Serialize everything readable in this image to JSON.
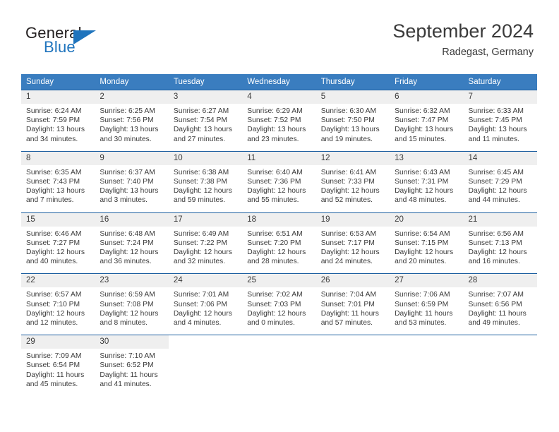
{
  "brand": {
    "name_part1": "General",
    "name_part2": "Blue",
    "mark": "triangle-logo"
  },
  "header": {
    "month_title": "September 2024",
    "location": "Radegast, Germany"
  },
  "calendar": {
    "weekday_headers": [
      "Sunday",
      "Monday",
      "Tuesday",
      "Wednesday",
      "Thursday",
      "Friday",
      "Saturday"
    ],
    "accent_header_color": "#3a7dbf",
    "accent_border_color": "#1d5fa0",
    "daynum_band_color": "#efefef",
    "weeks": [
      [
        {
          "day": "1",
          "sunrise": "Sunrise: 6:24 AM",
          "sunset": "Sunset: 7:59 PM",
          "daylight_line1": "Daylight: 13 hours",
          "daylight_line2": "and 34 minutes."
        },
        {
          "day": "2",
          "sunrise": "Sunrise: 6:25 AM",
          "sunset": "Sunset: 7:56 PM",
          "daylight_line1": "Daylight: 13 hours",
          "daylight_line2": "and 30 minutes."
        },
        {
          "day": "3",
          "sunrise": "Sunrise: 6:27 AM",
          "sunset": "Sunset: 7:54 PM",
          "daylight_line1": "Daylight: 13 hours",
          "daylight_line2": "and 27 minutes."
        },
        {
          "day": "4",
          "sunrise": "Sunrise: 6:29 AM",
          "sunset": "Sunset: 7:52 PM",
          "daylight_line1": "Daylight: 13 hours",
          "daylight_line2": "and 23 minutes."
        },
        {
          "day": "5",
          "sunrise": "Sunrise: 6:30 AM",
          "sunset": "Sunset: 7:50 PM",
          "daylight_line1": "Daylight: 13 hours",
          "daylight_line2": "and 19 minutes."
        },
        {
          "day": "6",
          "sunrise": "Sunrise: 6:32 AM",
          "sunset": "Sunset: 7:47 PM",
          "daylight_line1": "Daylight: 13 hours",
          "daylight_line2": "and 15 minutes."
        },
        {
          "day": "7",
          "sunrise": "Sunrise: 6:33 AM",
          "sunset": "Sunset: 7:45 PM",
          "daylight_line1": "Daylight: 13 hours",
          "daylight_line2": "and 11 minutes."
        }
      ],
      [
        {
          "day": "8",
          "sunrise": "Sunrise: 6:35 AM",
          "sunset": "Sunset: 7:43 PM",
          "daylight_line1": "Daylight: 13 hours",
          "daylight_line2": "and 7 minutes."
        },
        {
          "day": "9",
          "sunrise": "Sunrise: 6:37 AM",
          "sunset": "Sunset: 7:40 PM",
          "daylight_line1": "Daylight: 13 hours",
          "daylight_line2": "and 3 minutes."
        },
        {
          "day": "10",
          "sunrise": "Sunrise: 6:38 AM",
          "sunset": "Sunset: 7:38 PM",
          "daylight_line1": "Daylight: 12 hours",
          "daylight_line2": "and 59 minutes."
        },
        {
          "day": "11",
          "sunrise": "Sunrise: 6:40 AM",
          "sunset": "Sunset: 7:36 PM",
          "daylight_line1": "Daylight: 12 hours",
          "daylight_line2": "and 55 minutes."
        },
        {
          "day": "12",
          "sunrise": "Sunrise: 6:41 AM",
          "sunset": "Sunset: 7:33 PM",
          "daylight_line1": "Daylight: 12 hours",
          "daylight_line2": "and 52 minutes."
        },
        {
          "day": "13",
          "sunrise": "Sunrise: 6:43 AM",
          "sunset": "Sunset: 7:31 PM",
          "daylight_line1": "Daylight: 12 hours",
          "daylight_line2": "and 48 minutes."
        },
        {
          "day": "14",
          "sunrise": "Sunrise: 6:45 AM",
          "sunset": "Sunset: 7:29 PM",
          "daylight_line1": "Daylight: 12 hours",
          "daylight_line2": "and 44 minutes."
        }
      ],
      [
        {
          "day": "15",
          "sunrise": "Sunrise: 6:46 AM",
          "sunset": "Sunset: 7:27 PM",
          "daylight_line1": "Daylight: 12 hours",
          "daylight_line2": "and 40 minutes."
        },
        {
          "day": "16",
          "sunrise": "Sunrise: 6:48 AM",
          "sunset": "Sunset: 7:24 PM",
          "daylight_line1": "Daylight: 12 hours",
          "daylight_line2": "and 36 minutes."
        },
        {
          "day": "17",
          "sunrise": "Sunrise: 6:49 AM",
          "sunset": "Sunset: 7:22 PM",
          "daylight_line1": "Daylight: 12 hours",
          "daylight_line2": "and 32 minutes."
        },
        {
          "day": "18",
          "sunrise": "Sunrise: 6:51 AM",
          "sunset": "Sunset: 7:20 PM",
          "daylight_line1": "Daylight: 12 hours",
          "daylight_line2": "and 28 minutes."
        },
        {
          "day": "19",
          "sunrise": "Sunrise: 6:53 AM",
          "sunset": "Sunset: 7:17 PM",
          "daylight_line1": "Daylight: 12 hours",
          "daylight_line2": "and 24 minutes."
        },
        {
          "day": "20",
          "sunrise": "Sunrise: 6:54 AM",
          "sunset": "Sunset: 7:15 PM",
          "daylight_line1": "Daylight: 12 hours",
          "daylight_line2": "and 20 minutes."
        },
        {
          "day": "21",
          "sunrise": "Sunrise: 6:56 AM",
          "sunset": "Sunset: 7:13 PM",
          "daylight_line1": "Daylight: 12 hours",
          "daylight_line2": "and 16 minutes."
        }
      ],
      [
        {
          "day": "22",
          "sunrise": "Sunrise: 6:57 AM",
          "sunset": "Sunset: 7:10 PM",
          "daylight_line1": "Daylight: 12 hours",
          "daylight_line2": "and 12 minutes."
        },
        {
          "day": "23",
          "sunrise": "Sunrise: 6:59 AM",
          "sunset": "Sunset: 7:08 PM",
          "daylight_line1": "Daylight: 12 hours",
          "daylight_line2": "and 8 minutes."
        },
        {
          "day": "24",
          "sunrise": "Sunrise: 7:01 AM",
          "sunset": "Sunset: 7:06 PM",
          "daylight_line1": "Daylight: 12 hours",
          "daylight_line2": "and 4 minutes."
        },
        {
          "day": "25",
          "sunrise": "Sunrise: 7:02 AM",
          "sunset": "Sunset: 7:03 PM",
          "daylight_line1": "Daylight: 12 hours",
          "daylight_line2": "and 0 minutes."
        },
        {
          "day": "26",
          "sunrise": "Sunrise: 7:04 AM",
          "sunset": "Sunset: 7:01 PM",
          "daylight_line1": "Daylight: 11 hours",
          "daylight_line2": "and 57 minutes."
        },
        {
          "day": "27",
          "sunrise": "Sunrise: 7:06 AM",
          "sunset": "Sunset: 6:59 PM",
          "daylight_line1": "Daylight: 11 hours",
          "daylight_line2": "and 53 minutes."
        },
        {
          "day": "28",
          "sunrise": "Sunrise: 7:07 AM",
          "sunset": "Sunset: 6:56 PM",
          "daylight_line1": "Daylight: 11 hours",
          "daylight_line2": "and 49 minutes."
        }
      ],
      [
        {
          "day": "29",
          "sunrise": "Sunrise: 7:09 AM",
          "sunset": "Sunset: 6:54 PM",
          "daylight_line1": "Daylight: 11 hours",
          "daylight_line2": "and 45 minutes."
        },
        {
          "day": "30",
          "sunrise": "Sunrise: 7:10 AM",
          "sunset": "Sunset: 6:52 PM",
          "daylight_line1": "Daylight: 11 hours",
          "daylight_line2": "and 41 minutes."
        },
        {
          "day": "",
          "sunrise": "",
          "sunset": "",
          "daylight_line1": "",
          "daylight_line2": ""
        },
        {
          "day": "",
          "sunrise": "",
          "sunset": "",
          "daylight_line1": "",
          "daylight_line2": ""
        },
        {
          "day": "",
          "sunrise": "",
          "sunset": "",
          "daylight_line1": "",
          "daylight_line2": ""
        },
        {
          "day": "",
          "sunrise": "",
          "sunset": "",
          "daylight_line1": "",
          "daylight_line2": ""
        },
        {
          "day": "",
          "sunrise": "",
          "sunset": "",
          "daylight_line1": "",
          "daylight_line2": ""
        }
      ]
    ]
  }
}
